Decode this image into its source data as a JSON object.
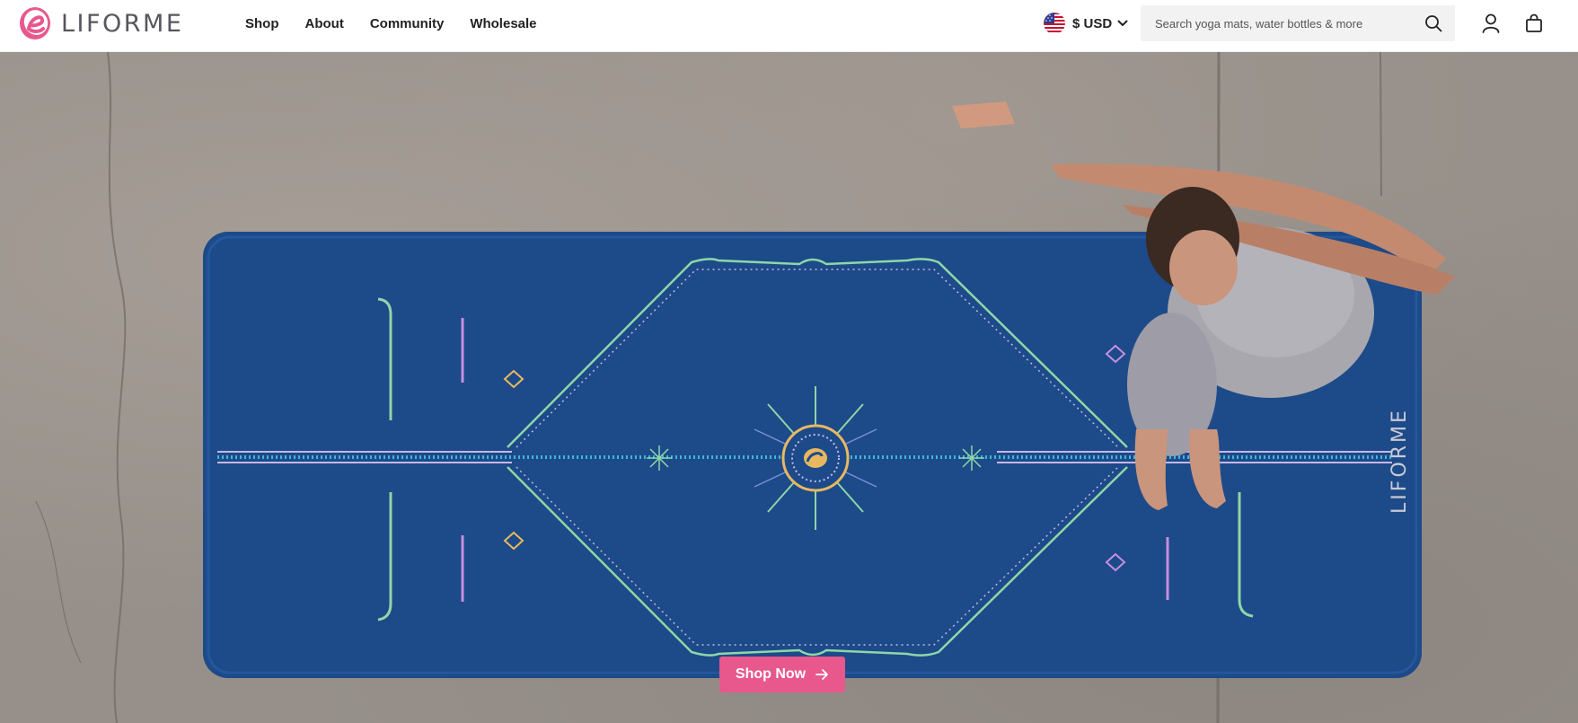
{
  "brand": {
    "name": "LIFORME",
    "accent_color": "#e8588c",
    "logo_icon": "liforme-swirl-logo-icon"
  },
  "nav": {
    "items": [
      {
        "label": "Shop"
      },
      {
        "label": "About"
      },
      {
        "label": "Community"
      },
      {
        "label": "Wholesale"
      }
    ]
  },
  "currency": {
    "flag_icon": "us-flag-icon",
    "label": "$ USD"
  },
  "search": {
    "placeholder": "Search yoga mats, water bottles & more",
    "value": ""
  },
  "header_icons": [
    "search-icon",
    "account-icon",
    "cart-icon"
  ],
  "hero": {
    "mat_print": "LIFORME",
    "mat_color": "#1f4e8c",
    "cta_label": "Shop Now",
    "cta_icon": "arrow-right-icon"
  }
}
